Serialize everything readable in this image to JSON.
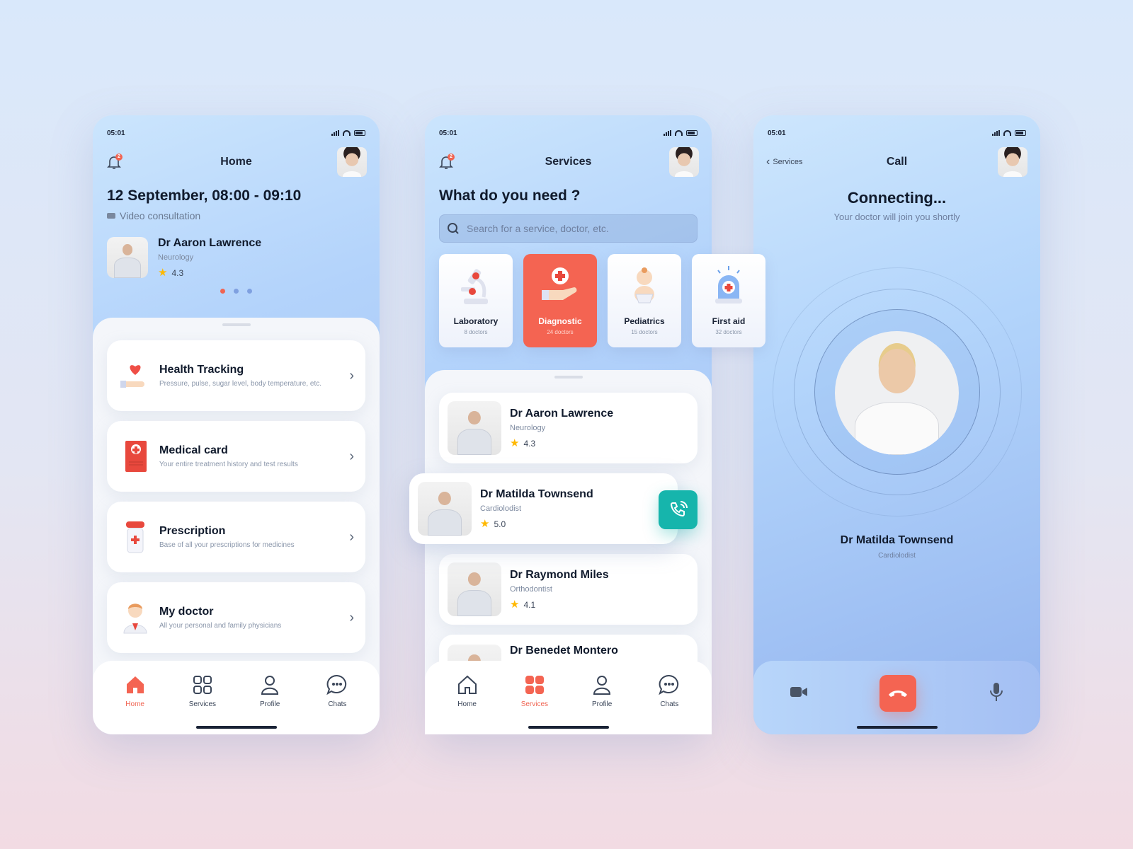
{
  "status_time": "05:01",
  "notification_count": "2",
  "home": {
    "title": "Home",
    "appointment": {
      "date": "12 September, 08:00 - 09:10",
      "type": "Video consultation",
      "doctor": {
        "name": "Dr Aaron Lawrence",
        "specialty": "Neurology",
        "rating": "4.3"
      }
    },
    "carousel": {
      "pages": 3,
      "active": 1
    },
    "menu": [
      {
        "title": "Health Tracking",
        "subtitle": "Pressure, pulse, sugar level, body temperature, etc.",
        "icon": "heart-hand-icon"
      },
      {
        "title": "Medical card",
        "subtitle": "Your entire treatment history and test results",
        "icon": "medical-card-icon"
      },
      {
        "title": "Prescription",
        "subtitle": "Base of all your prescriptions for medicines",
        "icon": "pill-bottle-icon"
      },
      {
        "title": "My doctor",
        "subtitle": "All your personal and family physicians",
        "icon": "doctor-icon"
      }
    ]
  },
  "tabs": [
    "Home",
    "Services",
    "Profile",
    "Chats"
  ],
  "services": {
    "title": "Services",
    "heading": "What do you need ?",
    "search_placeholder": "Search for a service, doctor, etc.",
    "categories": [
      {
        "label": "Laboratory",
        "count": "8 doctors",
        "icon": "microscope-icon"
      },
      {
        "label": "Diagnostic",
        "count": "24 doctors",
        "icon": "diagnostic-icon",
        "active": true
      },
      {
        "label": "Pediatrics",
        "count": "15 doctors",
        "icon": "baby-icon"
      },
      {
        "label": "First aid",
        "count": "32 doctors",
        "icon": "siren-icon"
      }
    ],
    "doctors": [
      {
        "name": "Dr Aaron Lawrence",
        "specialty": "Neurology",
        "rating": "4.3"
      },
      {
        "name": "Dr Matilda Townsend",
        "specialty": "Cardiolodist",
        "rating": "5.0"
      },
      {
        "name": "Dr Raymond Miles",
        "specialty": "Orthodontist",
        "rating": "4.1"
      },
      {
        "name": "Dr Benedet Montero",
        "specialty": "",
        "rating": ""
      }
    ]
  },
  "call": {
    "back_label": "Services",
    "title": "Call",
    "status": "Connecting...",
    "status_sub": "Your doctor will join you shortly",
    "doctor": {
      "name": "Dr Matilda Townsend",
      "specialty": "Cardiolodist"
    }
  },
  "colors": {
    "accent": "#f46452",
    "teal": "#16b5ac",
    "star": "#ffb800",
    "text": "#101a2c"
  }
}
